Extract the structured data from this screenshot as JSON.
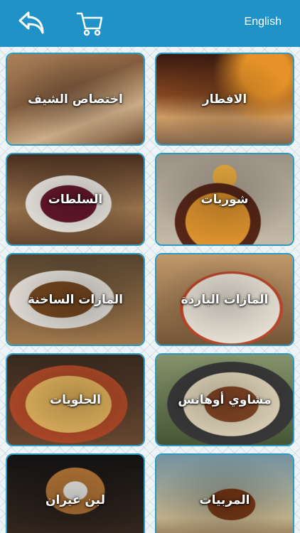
{
  "header": {
    "language_label": "English",
    "back_icon": "reply-arrow-icon",
    "cart_icon": "shopping-cart-icon",
    "bg_color": "#1f92c8"
  },
  "categories": [
    {
      "label": "اختصاص الشيف"
    },
    {
      "label": "الافطار"
    },
    {
      "label": "السلطات"
    },
    {
      "label": "شوربات"
    },
    {
      "label": "المازات الساخنة"
    },
    {
      "label": "المازات الباردة"
    },
    {
      "label": "الحلويات"
    },
    {
      "label": "مشاوي أوهانس"
    },
    {
      "label": "لبن عيران"
    },
    {
      "label": "المربيات"
    }
  ]
}
